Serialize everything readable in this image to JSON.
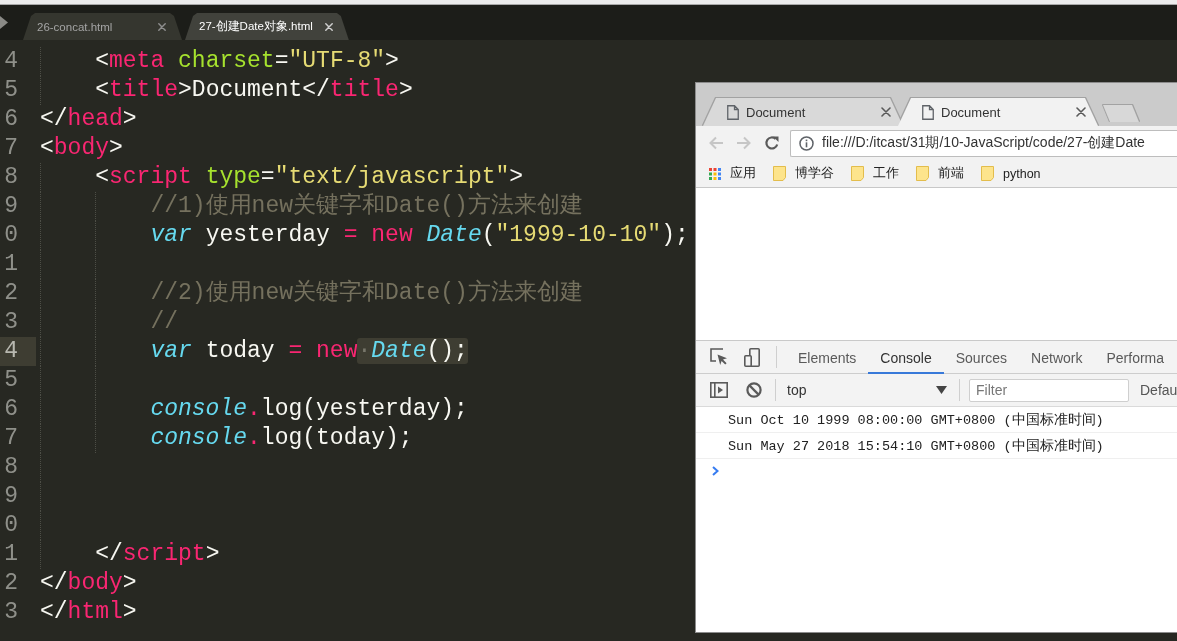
{
  "editor": {
    "tabs": [
      {
        "label": "26-concat.html",
        "selected": false
      },
      {
        "label": "27-创建Date对象.html",
        "selected": true
      }
    ],
    "lines": [
      {
        "number": "4",
        "current": false,
        "tokens": [
          {
            "text": "    <",
            "kind": "plain"
          },
          {
            "text": "meta",
            "kind": "tag"
          },
          {
            "text": " charset",
            "kind": "attr"
          },
          {
            "text": "=",
            "kind": "plain"
          },
          {
            "text": "\"UTF-8\"",
            "kind": "string"
          },
          {
            "text": ">",
            "kind": "plain"
          }
        ]
      },
      {
        "number": "5",
        "current": false,
        "tokens": [
          {
            "text": "    <",
            "kind": "plain"
          },
          {
            "text": "title",
            "kind": "tag"
          },
          {
            "text": ">Document</",
            "kind": "plain"
          },
          {
            "text": "title",
            "kind": "tag"
          },
          {
            "text": ">",
            "kind": "plain"
          }
        ]
      },
      {
        "number": "6",
        "current": false,
        "tokens": [
          {
            "text": "</",
            "kind": "plain"
          },
          {
            "text": "head",
            "kind": "tag"
          },
          {
            "text": ">",
            "kind": "plain"
          }
        ]
      },
      {
        "number": "7",
        "current": false,
        "tokens": [
          {
            "text": "<",
            "kind": "plain"
          },
          {
            "text": "body",
            "kind": "tag"
          },
          {
            "text": ">",
            "kind": "plain"
          }
        ]
      },
      {
        "number": "8",
        "current": false,
        "tokens": [
          {
            "text": "    <",
            "kind": "plain"
          },
          {
            "text": "script",
            "kind": "tag"
          },
          {
            "text": " type",
            "kind": "attr"
          },
          {
            "text": "=",
            "kind": "plain"
          },
          {
            "text": "\"text/javascript\"",
            "kind": "string"
          },
          {
            "text": ">",
            "kind": "plain"
          }
        ]
      },
      {
        "number": "9",
        "current": false,
        "tokens": [
          {
            "text": "        //1)使用new关键字和Date()方法来创建",
            "kind": "comment"
          }
        ]
      },
      {
        "number": "0",
        "current": false,
        "tokens": [
          {
            "text": "        var",
            "kind": "keyword"
          },
          {
            "text": " yesterday ",
            "kind": "plain"
          },
          {
            "text": "=",
            "kind": "op"
          },
          {
            "text": " new",
            "kind": "op"
          },
          {
            "text": " Date",
            "kind": "class"
          },
          {
            "text": "(",
            "kind": "plain"
          },
          {
            "text": "\"1999-10-10\"",
            "kind": "string"
          },
          {
            "text": ");",
            "kind": "plain"
          }
        ]
      },
      {
        "number": "1",
        "current": false
      },
      {
        "number": "2",
        "current": false,
        "tokens": [
          {
            "text": "        //2)使用new关键字和Date()方法来创建",
            "kind": "comment"
          }
        ]
      },
      {
        "number": "3",
        "current": false,
        "tokens": [
          {
            "text": "        //",
            "kind": "comment"
          }
        ]
      },
      {
        "number": "4",
        "current": true,
        "tokens": [
          {
            "text": "        var",
            "kind": "keyword"
          },
          {
            "text": " today ",
            "kind": "plain"
          },
          {
            "text": "=",
            "kind": "op"
          },
          {
            "text": " new",
            "kind": "op"
          },
          {
            "kind": "selection",
            "tokens": [
              {
                "text": "·",
                "kind": "whitespace"
              },
              {
                "text": "Date",
                "kind": "class"
              },
              {
                "text": "();",
                "kind": "plain"
              }
            ]
          }
        ]
      },
      {
        "number": "5",
        "current": false
      },
      {
        "number": "6",
        "current": false,
        "tokens": [
          {
            "text": "        console",
            "kind": "class"
          },
          {
            "text": ".",
            "kind": "op"
          },
          {
            "text": "log(yesterday);",
            "kind": "plain"
          }
        ]
      },
      {
        "number": "7",
        "current": false,
        "tokens": [
          {
            "text": "        console",
            "kind": "class"
          },
          {
            "text": ".",
            "kind": "op"
          },
          {
            "text": "log(today);",
            "kind": "plain"
          }
        ]
      },
      {
        "number": "8",
        "current": false
      },
      {
        "number": "9",
        "current": false
      },
      {
        "number": "0",
        "current": false
      },
      {
        "number": "1",
        "current": false,
        "tokens": [
          {
            "text": "    </",
            "kind": "plain"
          },
          {
            "text": "script",
            "kind": "tag"
          },
          {
            "text": ">",
            "kind": "plain"
          }
        ]
      },
      {
        "number": "2",
        "current": false,
        "tokens": [
          {
            "text": "</",
            "kind": "plain"
          },
          {
            "text": "body",
            "kind": "tag"
          },
          {
            "text": ">",
            "kind": "plain"
          }
        ]
      },
      {
        "number": "3",
        "current": false,
        "tokens": [
          {
            "text": "</",
            "kind": "plain"
          },
          {
            "text": "html",
            "kind": "tag"
          },
          {
            "text": ">",
            "kind": "plain"
          }
        ]
      }
    ]
  },
  "browser": {
    "tabs": [
      {
        "title": "Document",
        "selected": false
      },
      {
        "title": "Document",
        "selected": true
      }
    ],
    "nav_buttons": [
      {
        "kind": "back",
        "disabled": true
      },
      {
        "kind": "forward",
        "disabled": true
      },
      {
        "kind": "reload",
        "disabled": false
      }
    ],
    "address": "file:///D:/itcast/31期/10-JavaScript/code/27-创建Date",
    "bookmarks": [
      {
        "kind": "apps",
        "label": "应用"
      },
      {
        "kind": "folder",
        "label": "博学谷"
      },
      {
        "kind": "folder",
        "label": "工作"
      },
      {
        "kind": "folder",
        "label": "前端"
      },
      {
        "kind": "folder",
        "label": "python"
      }
    ],
    "devtools": {
      "tabs": [
        {
          "label": "Elements",
          "selected": false
        },
        {
          "label": "Console",
          "selected": true
        },
        {
          "label": "Sources",
          "selected": false
        },
        {
          "label": "Network",
          "selected": false
        },
        {
          "label": "Performa",
          "selected": false
        }
      ],
      "context": "top",
      "filter": {
        "placeholder": "Filter"
      },
      "levels": "Defau",
      "messages": [
        "Sun Oct 10 1999 08:00:00 GMT+0800 (中国标准时间)",
        "Sun May 27 2018 15:54:10 GMT+0800 (中国标准时间)"
      ]
    }
  }
}
